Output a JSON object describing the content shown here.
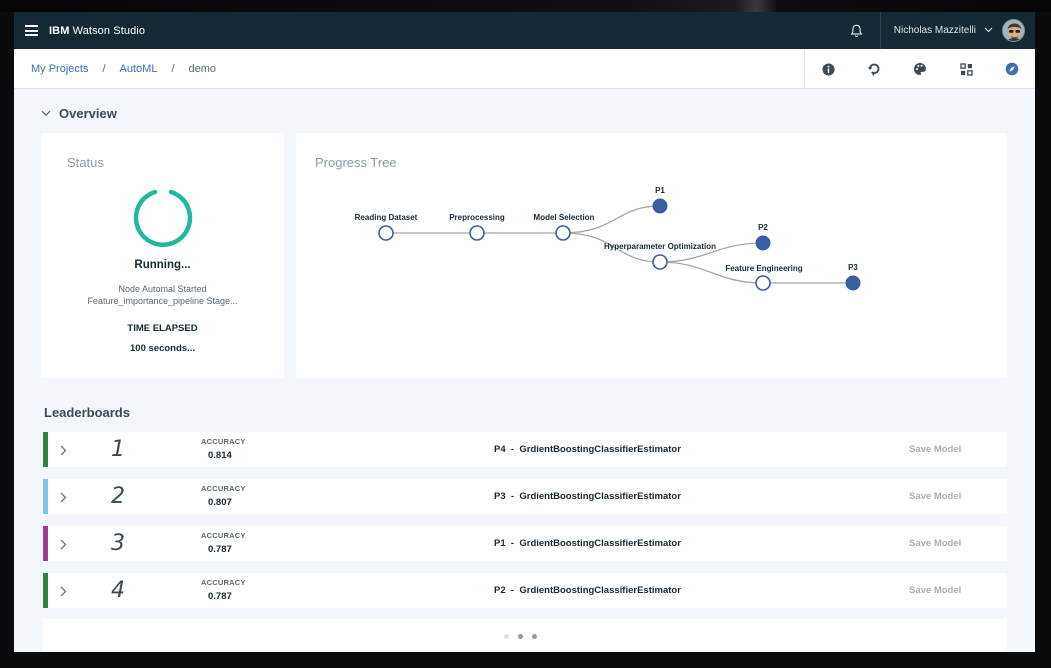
{
  "header": {
    "app_title_prefix": "IBM",
    "app_title": "Watson Studio",
    "user_name": "Nicholas Mazzitelli"
  },
  "breadcrumb": [
    "My Projects",
    "AutoML",
    "demo"
  ],
  "toolbar_icons": [
    "info-icon",
    "undo-deploy-icon",
    "palette-icon",
    "grid-icon",
    "compass-icon"
  ],
  "overview": {
    "title": "Overview"
  },
  "status": {
    "title": "Status",
    "state": "Running...",
    "message_line1": "Node Automal Started",
    "message_line2": "Feature_importance_pipeline Stage...",
    "elapsed_label": "TIME ELAPSED",
    "elapsed_value": "100 seconds..."
  },
  "progress_tree": {
    "title": "Progress Tree",
    "nodes": {
      "reading": "Reading Dataset",
      "preprocessing": "Preprocessing",
      "model_selection": "Model Selection",
      "hpo": "Hyperparameter Optimization",
      "feature_engineering": "Feature Engineering",
      "p1": "P1",
      "p2": "P2",
      "p3": "P3"
    }
  },
  "leaderboards": {
    "title": "Leaderboards",
    "accuracy_label": "ACCURACY",
    "save_label": "Save Model",
    "rows": [
      {
        "rank": "1",
        "accuracy": "0.814",
        "pipeline": "P4",
        "estimator": "GrdientBoostingClassifierEstimator",
        "color": "#2e8540"
      },
      {
        "rank": "2",
        "accuracy": "0.807",
        "pipeline": "P3",
        "estimator": "GrdientBoostingClassifierEstimator",
        "color": "#7cc7e8"
      },
      {
        "rank": "3",
        "accuracy": "0.787",
        "pipeline": "P1",
        "estimator": "GrdientBoostingClassifierEstimator",
        "color": "#9b3c8c"
      },
      {
        "rank": "4",
        "accuracy": "0.787",
        "pipeline": "P2",
        "estimator": "GrdientBoostingClassifierEstimator",
        "color": "#2e8540"
      }
    ]
  },
  "colors": {
    "header": "#152935",
    "spinner": "#1fb8a0",
    "node_filled": "#3b5fa0",
    "link": "#3d70b2"
  }
}
